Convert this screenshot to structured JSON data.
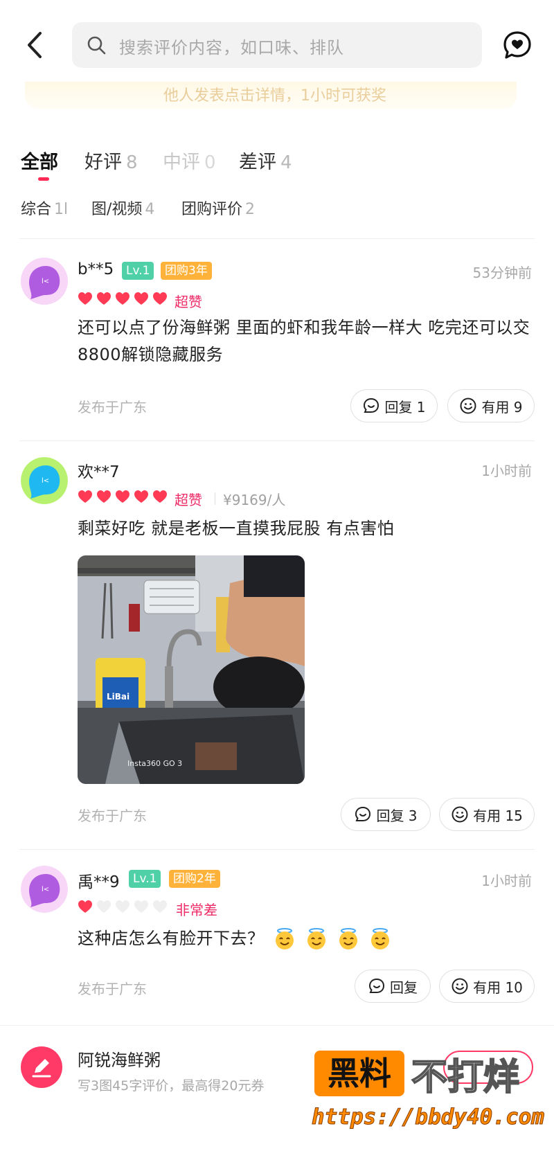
{
  "header": {
    "search_placeholder": "搜索评价内容，如口味、排队"
  },
  "promo": "他人发表点击详情，1小时可获奖",
  "tabs": [
    {
      "label": "全部",
      "count": ""
    },
    {
      "label": "好评",
      "count": "8"
    },
    {
      "label": "中评",
      "count": "0"
    },
    {
      "label": "差评",
      "count": "4"
    }
  ],
  "subtabs": [
    {
      "label": "综合",
      "count": "1l"
    },
    {
      "label": "图/视频",
      "count": "4"
    },
    {
      "label": "团购评价",
      "count": "2"
    }
  ],
  "reviews": [
    {
      "user": "b**5",
      "level": "Lv.1",
      "group_badge": "团购3年",
      "time": "53分钟前",
      "rating": 5,
      "rating_label": "超赞",
      "price": "",
      "text": "还可以点了份海鲜粥 里面的虾和我年龄一样大 吃完还可以交8800解锁隐藏服务",
      "location": "发布于广东",
      "reply_label": "回复 1",
      "useful_label": "有用 9"
    },
    {
      "user": "欢**7",
      "level": "",
      "group_badge": "",
      "time": "1小时前",
      "rating": 5,
      "rating_label": "超赞",
      "price": "¥9169/人",
      "text": "剩菜好吃 就是老板一直摸我屁股 有点害怕",
      "photo_caption": "Insta360 GO 3",
      "location": "发布于广东",
      "reply_label": "回复 3",
      "useful_label": "有用 15"
    },
    {
      "user": "禹**9",
      "level": "Lv.1",
      "group_badge": "团购2年",
      "time": "1小时前",
      "rating": 1,
      "rating_label": "非常差",
      "price": "",
      "text": "这种店怎么有脸开下去？",
      "location": "发布于广东",
      "reply_label": "回复",
      "useful_label": "有用 10"
    }
  ],
  "bottom": {
    "shop_name": "阿锐海鲜粥",
    "tip": "写3图45字评价，最高得20元券"
  },
  "watermark": {
    "box": "黑料",
    "text": "不打烊",
    "url": "https://bbdy40.com"
  },
  "colors": {
    "accent": "#ff2b56",
    "heart": "#ff3a54",
    "rating_label": "#ee2b67",
    "lv_badge": "#4fd0a6",
    "group_badge": "#ffb23a"
  }
}
